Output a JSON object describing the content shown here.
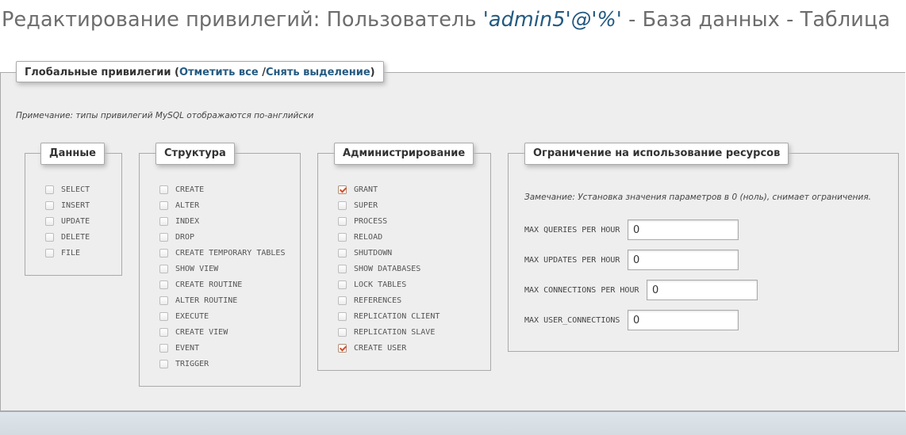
{
  "page": {
    "title_prefix": "Редактирование привилегий: Пользователь ",
    "title_user": "'admin5'@'%'",
    "title_suffix": " - База данных - Таблица"
  },
  "global": {
    "legend_title": "Глобальные привилегии (",
    "check_all": "Отметить все",
    "separator": " /",
    "uncheck_all": "Снять выделение",
    "close_paren": ")",
    "note": "Примечание: типы привилегий MySQL отображаются по-английски"
  },
  "groups": {
    "data": {
      "legend": "Данные",
      "items": [
        {
          "label": "SELECT",
          "checked": false
        },
        {
          "label": "INSERT",
          "checked": false
        },
        {
          "label": "UPDATE",
          "checked": false
        },
        {
          "label": "DELETE",
          "checked": false
        },
        {
          "label": "FILE",
          "checked": false
        }
      ]
    },
    "structure": {
      "legend": "Структура",
      "items": [
        {
          "label": "CREATE",
          "checked": false
        },
        {
          "label": "ALTER",
          "checked": false
        },
        {
          "label": "INDEX",
          "checked": false
        },
        {
          "label": "DROP",
          "checked": false
        },
        {
          "label": "CREATE TEMPORARY TABLES",
          "checked": false
        },
        {
          "label": "SHOW VIEW",
          "checked": false
        },
        {
          "label": "CREATE ROUTINE",
          "checked": false
        },
        {
          "label": "ALTER ROUTINE",
          "checked": false
        },
        {
          "label": "EXECUTE",
          "checked": false
        },
        {
          "label": "CREATE VIEW",
          "checked": false
        },
        {
          "label": "EVENT",
          "checked": false
        },
        {
          "label": "TRIGGER",
          "checked": false
        }
      ]
    },
    "admin": {
      "legend": "Администрирование",
      "items": [
        {
          "label": "GRANT",
          "checked": true
        },
        {
          "label": "SUPER",
          "checked": false
        },
        {
          "label": "PROCESS",
          "checked": false
        },
        {
          "label": "RELOAD",
          "checked": false
        },
        {
          "label": "SHUTDOWN",
          "checked": false
        },
        {
          "label": "SHOW DATABASES",
          "checked": false
        },
        {
          "label": "LOCK TABLES",
          "checked": false
        },
        {
          "label": "REFERENCES",
          "checked": false
        },
        {
          "label": "REPLICATION CLIENT",
          "checked": false
        },
        {
          "label": "REPLICATION SLAVE",
          "checked": false
        },
        {
          "label": "CREATE USER",
          "checked": true
        }
      ]
    }
  },
  "limits": {
    "legend": "Ограничение на использование ресурсов",
    "note": "Замечание: Установка значения параметров в 0 (ноль), снимает ограничения.",
    "fields": [
      {
        "label": "MAX QUERIES PER HOUR",
        "value": "0"
      },
      {
        "label": "MAX UPDATES PER HOUR",
        "value": "0"
      },
      {
        "label": "MAX CONNECTIONS PER HOUR",
        "value": "0"
      },
      {
        "label": "MAX USER_CONNECTIONS",
        "value": "0"
      }
    ]
  },
  "colors": {
    "link": "#235a81",
    "check": "#d0512c",
    "panel_bg": "#eeeeee",
    "border": "#aaaaaa"
  }
}
